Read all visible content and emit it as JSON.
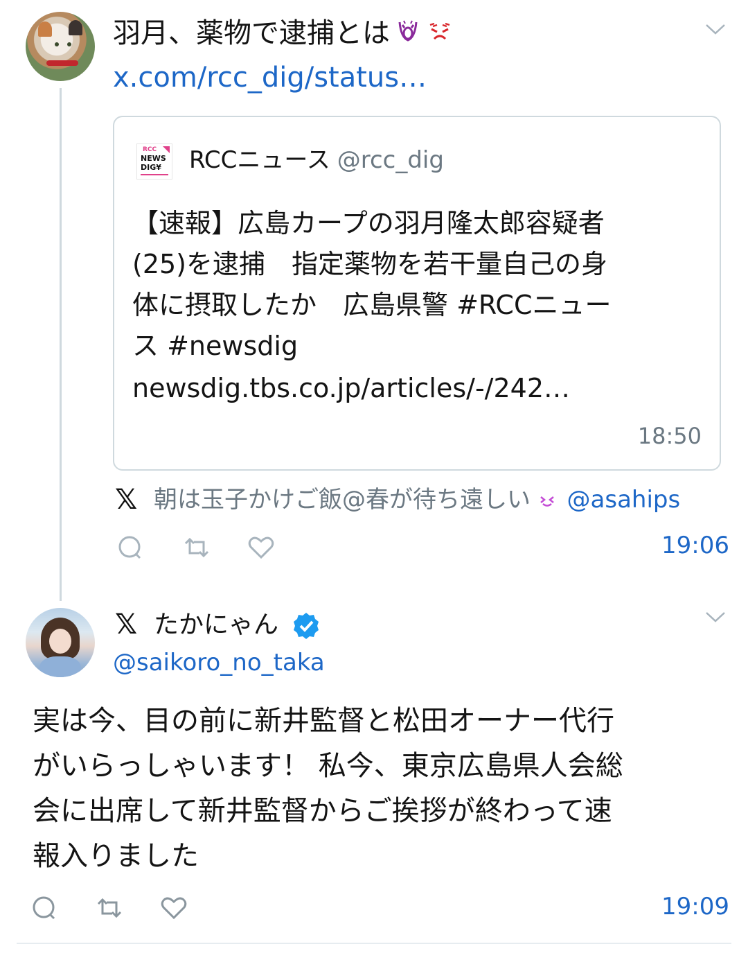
{
  "tweet1": {
    "text": "羽月、薬物で逮捕とは",
    "link": "x.com/rcc_dig/status…",
    "emoji_icons": [
      "open-mouth-shock-icon",
      "angry-face-icon"
    ]
  },
  "quote": {
    "account_name": "RCCニュース",
    "account_handle": "@rcc_dig",
    "logo_text": [
      "RCC",
      "NEWS",
      "DIG¥"
    ],
    "body_lines": [
      "【速報】広島カープの羽月隆太郎容疑者",
      "(25)を逮捕　指定薬物を若干量自己の身",
      "体に摂取したか　広島県警 #RCCニュー",
      "ス #newsdig"
    ],
    "url": "newsdig.tbs.co.jp/articles/-/242…",
    "time": "18:50"
  },
  "attribution": {
    "name": "朝は玉子かけご飯@春が待ち遠しい",
    "handle": "@asahips",
    "x_logo": "𝕏"
  },
  "actions1": {
    "time": "19:06"
  },
  "tweet2": {
    "x_logo": "𝕏",
    "name": "たかにゃん",
    "handle": "@saikoro_no_taka",
    "body_lines": [
      "実は今、目の前に新井監督と松田オーナー代行",
      "がいらっしゃいます！ 私今、東京広島県人会総",
      "会に出席して新井監督からご挨拶が終わって速",
      "報入りました"
    ],
    "time": "19:09"
  },
  "colors": {
    "link_blue": "#1d67c7",
    "muted_gray": "#6b7882",
    "border": "#cfd9de",
    "verified_blue": "#1d9bf0",
    "accent_pink": "#e0418a"
  }
}
